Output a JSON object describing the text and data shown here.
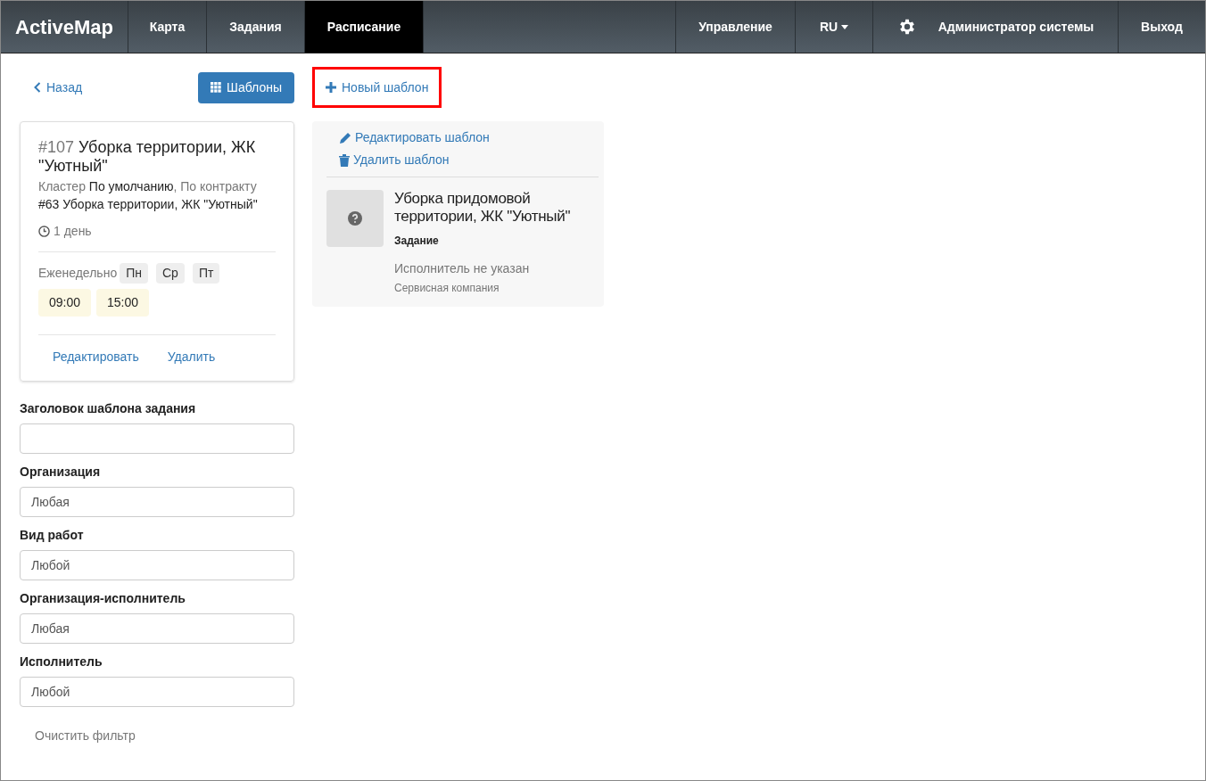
{
  "navbar": {
    "brand": "ActiveMap",
    "tabs": [
      {
        "label": "Карта",
        "selected": false
      },
      {
        "label": "Задания",
        "selected": false
      },
      {
        "label": "Расписание",
        "selected": true
      }
    ],
    "right": [
      {
        "kind": "link",
        "label": "Управление"
      },
      {
        "kind": "dropdown",
        "label": "RU"
      },
      {
        "kind": "user",
        "label": "Администратор системы"
      },
      {
        "kind": "link",
        "label": "Выход"
      }
    ]
  },
  "toolbar": {
    "back": "Назад",
    "templates": "Шаблоны",
    "new_template": {
      "label": "Новый шаблон",
      "highlighted": true
    }
  },
  "schedule_card": {
    "number": "#107",
    "title": "Уборка территории, ЖК \"Уютный\"",
    "meta": [
      {
        "kind": "label",
        "text": "Кластер "
      },
      {
        "kind": "value",
        "text": "По умолчанию"
      },
      {
        "kind": "label",
        "text": ", По контракту "
      },
      {
        "kind": "value",
        "text": "#63 Уборка территории, ЖК \"Уютный\""
      }
    ],
    "duration": "1 день",
    "frequency": "Еженедельно",
    "days": [
      "Пн",
      "Ср",
      "Пт"
    ],
    "times": [
      "09:00",
      "15:00"
    ],
    "actions": [
      "Редактировать",
      "Удалить"
    ]
  },
  "filters": [
    {
      "label": "Заголовок шаблона задания"
    },
    {
      "label": "Организация",
      "value": "Любая"
    },
    {
      "label": "Вид работ",
      "value": "Любой"
    },
    {
      "label": "Организация-исполнитель",
      "value": "Любая"
    },
    {
      "label": "Исполнитель",
      "value": "Любой"
    }
  ],
  "clear_filter": "Очистить фильтр",
  "template_panel": {
    "actions": [
      {
        "kind": "edit",
        "label": "Редактировать шаблон"
      },
      {
        "kind": "delete",
        "label": "Удалить шаблон"
      }
    ],
    "title": "Уборка придомовой территории, ЖК \"Уютный\"",
    "type": "Задание",
    "executor": "Исполнитель не указан",
    "company": "Сервисная компания"
  }
}
